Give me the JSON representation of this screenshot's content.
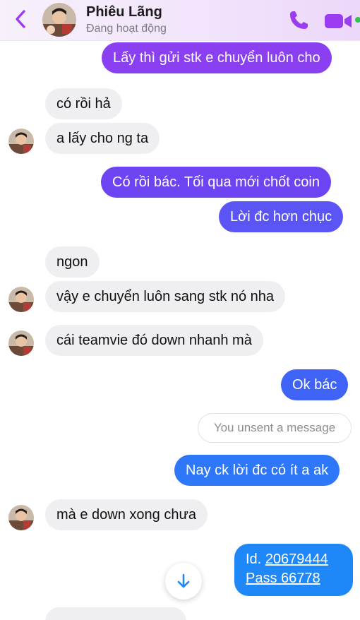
{
  "header": {
    "contact_name": "Phiêu Lãng",
    "status": "Đang hoạt động",
    "icons": {
      "back": "chevron-left-icon",
      "call": "phone-icon",
      "video": "video-camera-icon"
    },
    "accent_color": "#9b3cf0"
  },
  "messages": [
    {
      "from": "me",
      "text": "Lấy thì gửi stk e chuyển luôn cho"
    },
    {
      "from": "contact",
      "text": "có rồi hả"
    },
    {
      "from": "contact",
      "text": "a lấy cho ng ta"
    },
    {
      "from": "me",
      "text": "Có rồi bác. Tối qua mới chốt coin"
    },
    {
      "from": "me",
      "text": "Lời đc hơn chục"
    },
    {
      "from": "contact",
      "text": "ngon"
    },
    {
      "from": "contact",
      "text": "vậy e chuyển luôn sang stk nó nha"
    },
    {
      "from": "contact",
      "text": "cái teamvie đó down nhanh mà"
    },
    {
      "from": "me",
      "text": "Ok bác"
    },
    {
      "from": "system",
      "text": "You unsent a message"
    },
    {
      "from": "me",
      "text": "Nay ck lời đc có ít a ak"
    },
    {
      "from": "contact",
      "text": "mà e down xong chưa"
    }
  ],
  "credentials_message": {
    "id_label": "Id.",
    "id_value": "20679444",
    "pass_label": "Pass",
    "pass_value": "66778"
  },
  "scroll_button": {
    "icon": "arrow-down-icon"
  }
}
